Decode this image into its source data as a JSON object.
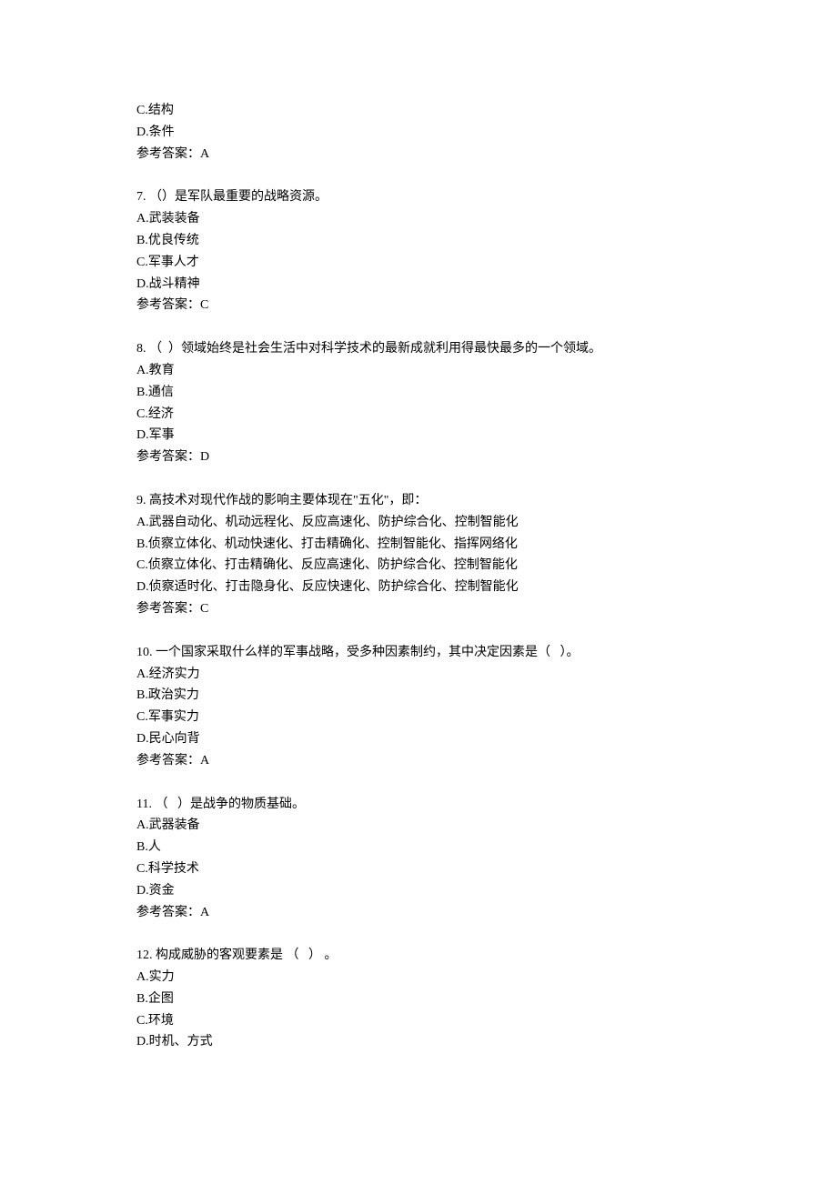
{
  "partial_q6": {
    "options": [
      "C.结构",
      "D.条件"
    ],
    "answer": "参考答案：A"
  },
  "questions": [
    {
      "stem": "7. （）是军队最重要的战略资源。",
      "options": [
        "A.武装装备",
        "B.优良传统",
        "C.军事人才",
        "D.战斗精神"
      ],
      "answer": "参考答案：C"
    },
    {
      "stem": "8. （  ）领域始终是社会生活中对科学技术的最新成就利用得最快最多的一个领域。",
      "options": [
        "A.教育",
        "B.通信",
        "C.经济",
        "D.军事"
      ],
      "answer": "参考答案：D"
    },
    {
      "stem": "9. 高技术对现代作战的影响主要体现在\"五化\"，即：",
      "options": [
        "A.武器自动化、机动远程化、反应高速化、防护综合化、控制智能化",
        "B.侦察立体化、机动快速化、打击精确化、控制智能化、指挥网络化",
        "C.侦察立体化、打击精确化、反应高速化、防护综合化、控制智能化",
        "D.侦察适时化、打击隐身化、反应快速化、防护综合化、控制智能化"
      ],
      "answer": "参考答案：C"
    },
    {
      "stem": "10. 一个国家采取什么样的军事战略，受多种因素制约，其中决定因素是（   ）。",
      "options": [
        "A.经济实力",
        "B.政治实力",
        "C.军事实力",
        "D.民心向背"
      ],
      "answer": "参考答案：A"
    },
    {
      "stem": "11. （   ）是战争的物质基础。",
      "options": [
        "A.武器装备",
        "B.人",
        "C.科学技术",
        "D.资金"
      ],
      "answer": "参考答案：A"
    },
    {
      "stem": "12. 构成威胁的客观要素是 （   ） 。",
      "options": [
        "A.实力",
        "B.企图",
        "C.环境",
        "D.时机、方式"
      ],
      "answer": ""
    }
  ]
}
